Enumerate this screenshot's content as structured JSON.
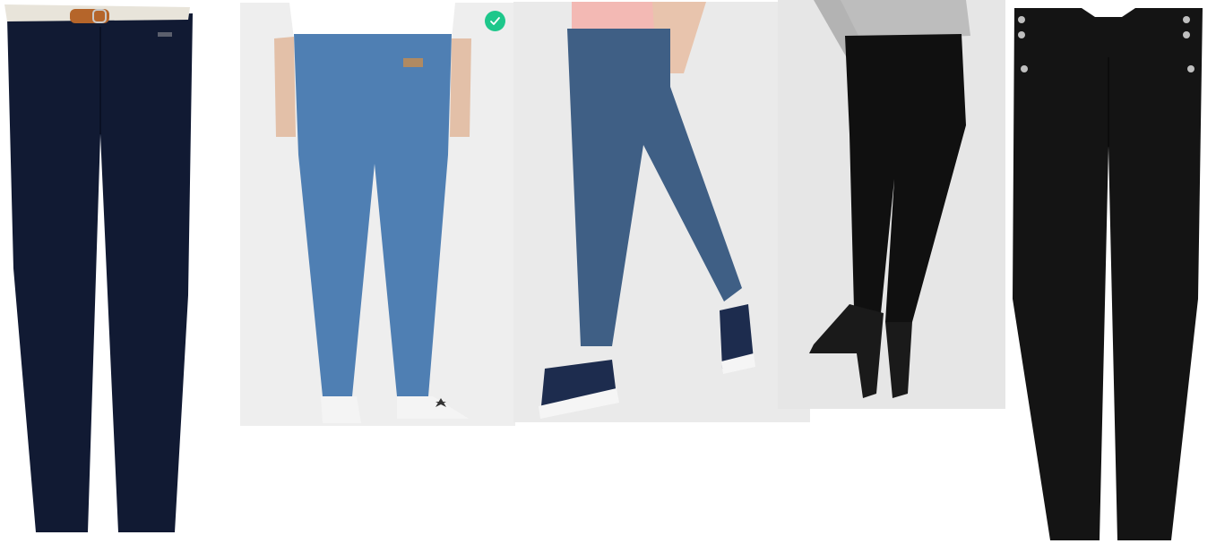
{
  "products": [
    {
      "id": "navy-chino-with-belt",
      "bg": "#ffffff",
      "main": "#111a33"
    },
    {
      "id": "light-blue-skinny-jeans",
      "bg": "#eeeeee",
      "main": "#4f7fb3"
    },
    {
      "id": "mid-blue-straight-jeans",
      "bg": "#eaeaea",
      "main": "#3f5f85"
    },
    {
      "id": "black-skinny-pants-with-heels",
      "bg": "#e6e6e6",
      "main": "#101010"
    },
    {
      "id": "black-high-waist-button-pants",
      "bg": "#ffffff",
      "main": "#141414"
    }
  ],
  "selection": {
    "selected_index": 1,
    "badge_color": "#1ec78b"
  }
}
